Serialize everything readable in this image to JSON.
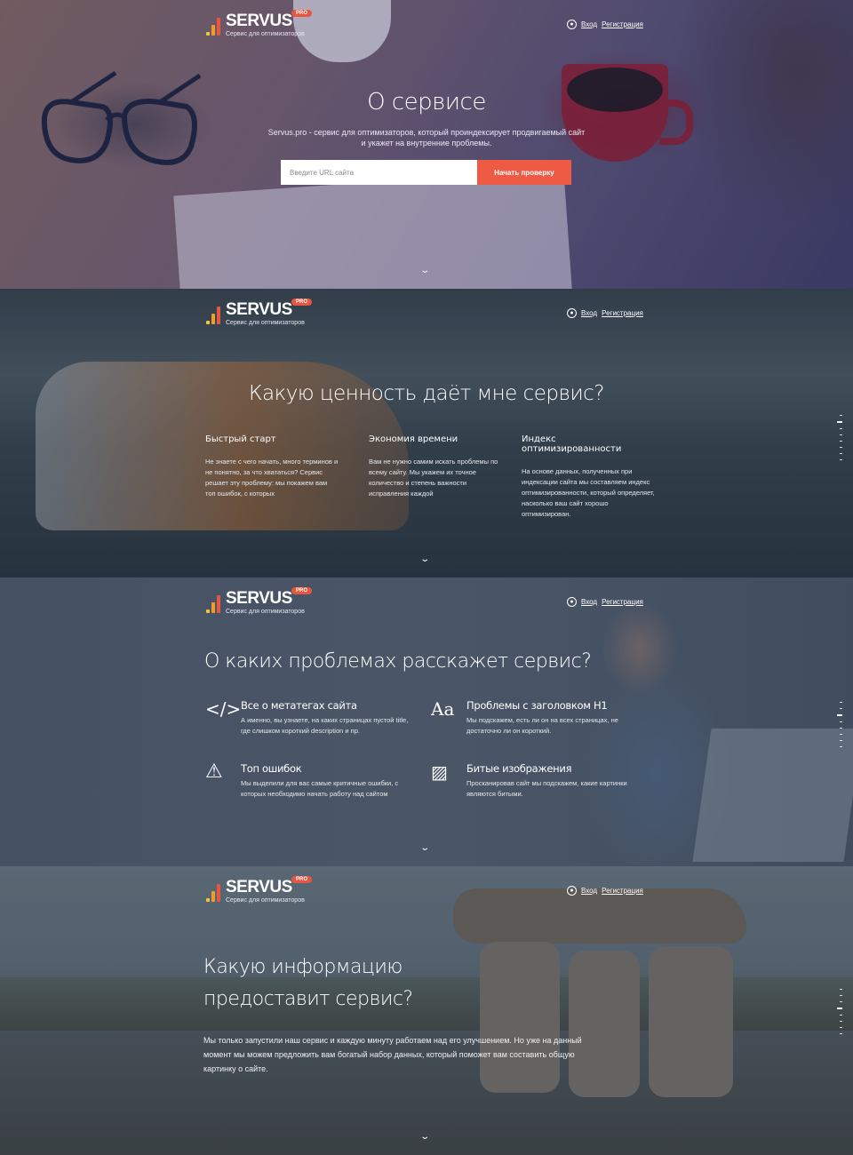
{
  "header": {
    "logo_name": "SERVUS",
    "logo_badge": "PRO",
    "logo_subtitle": "Сервис для оптимизаторов",
    "login": "Вход",
    "register": "Регистрация"
  },
  "colors": {
    "accent": "#ef5a45",
    "logo_bar_1": "#f6c23e",
    "logo_bar_2": "#f39c2b",
    "logo_bar_3": "#e8563f"
  },
  "section1": {
    "title": "О сервисе",
    "description": "Servus.pro - сервис для оптимизаторов, который проиндексирует продвигаемый сайт и укажет на внутренние проблемы.",
    "url_placeholder": "Введите URL сайта",
    "check_button": "Начать проверку"
  },
  "section2": {
    "title": "Какую ценность даёт мне сервис?",
    "columns": [
      {
        "heading": "Быстрый старт",
        "text": "Не знаете с чего начать, много терминов и не понятно, за что хвататься? Сервис решает эту проблему: мы покажем вам топ ошибок, с которых"
      },
      {
        "heading": "Экономия времени",
        "text": "Вам не нужно самим искать проблемы по всему сайту. Мы укажем их точное количество и степень важности исправления каждой"
      },
      {
        "heading": "Индекс оптимизированности",
        "text": "На основе данных, полученных при индексации сайта мы составляем индекс оптимизированности, который определяет, насколько ваш сайт хорошо оптимизирован."
      }
    ]
  },
  "section3": {
    "title": "О каких проблемах расскажет сервис?",
    "features": [
      {
        "icon": "code-icon",
        "glyph": "</>",
        "heading": "Все о метатегах сайта",
        "text": "А именно, вы узнаете, на каких страницах пустой title, где слишком короткий description и пр."
      },
      {
        "icon": "typography-icon",
        "glyph": "Aa",
        "heading": "Проблемы с заголовком H1",
        "text": "Мы подскажем, есть ли он на всех страницах, не достаточно ли он короткий."
      },
      {
        "icon": "warning-icon",
        "glyph": "⚠",
        "heading": "Топ ошибок",
        "text": "Мы выделили для вас самые критичные ошибки, с которых необходимо начать работу над сайтом"
      },
      {
        "icon": "broken-image-icon",
        "glyph": "▨",
        "heading": "Битые изображения",
        "text": "Просканировав сайт мы подскажем, какие картинки являются битыми."
      }
    ]
  },
  "section4": {
    "title": "Какую информацию предоставит сервис?",
    "description": "Мы только запустили наш сервис и каждую минуту работаем над его улучшением. Но уже на данный момент мы можем предложить вам богатый набор данных, который поможет вам составить общую картинку о сайте."
  },
  "pagination": {
    "count": 8,
    "active_by_section": [
      1,
      2,
      3,
      4
    ]
  }
}
